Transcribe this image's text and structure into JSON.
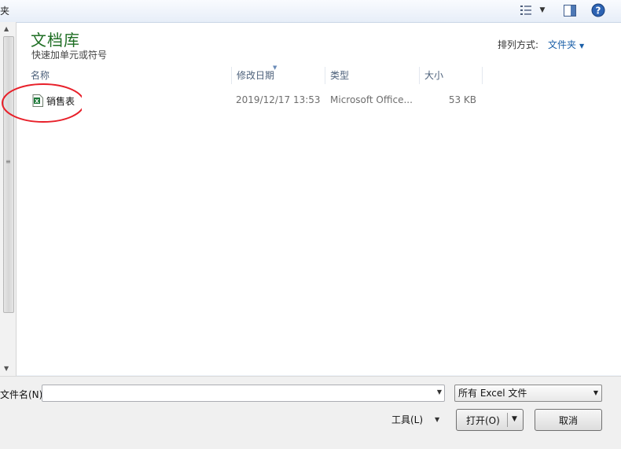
{
  "topbar": {
    "left_cut_text": "夹",
    "icons": [
      "views-icon",
      "chevron-down-icon",
      "preview-pane-icon",
      "help-icon"
    ]
  },
  "library": {
    "title": "文档库",
    "subtitle": "快速加单元或符号",
    "arrange_label": "排列方式:",
    "arrange_value": "文件夹"
  },
  "columns": {
    "name": "名称",
    "date": "修改日期",
    "type": "类型",
    "size": "大小"
  },
  "files": [
    {
      "name": "销售表",
      "date": "2019/12/17 13:53",
      "type": "Microsoft Office...",
      "size": "53 KB",
      "icon": "excel-file-icon"
    }
  ],
  "footer": {
    "filename_label": "文件名(N):",
    "filename_value": "",
    "filetype_value": "所有 Excel 文件",
    "tools_label": "工具(L)",
    "open_label": "打开(O)",
    "cancel_label": "取消"
  },
  "colors": {
    "title_green": "#1e6e23",
    "link_blue": "#1a5fa8",
    "annotation_red": "#e8202a"
  }
}
